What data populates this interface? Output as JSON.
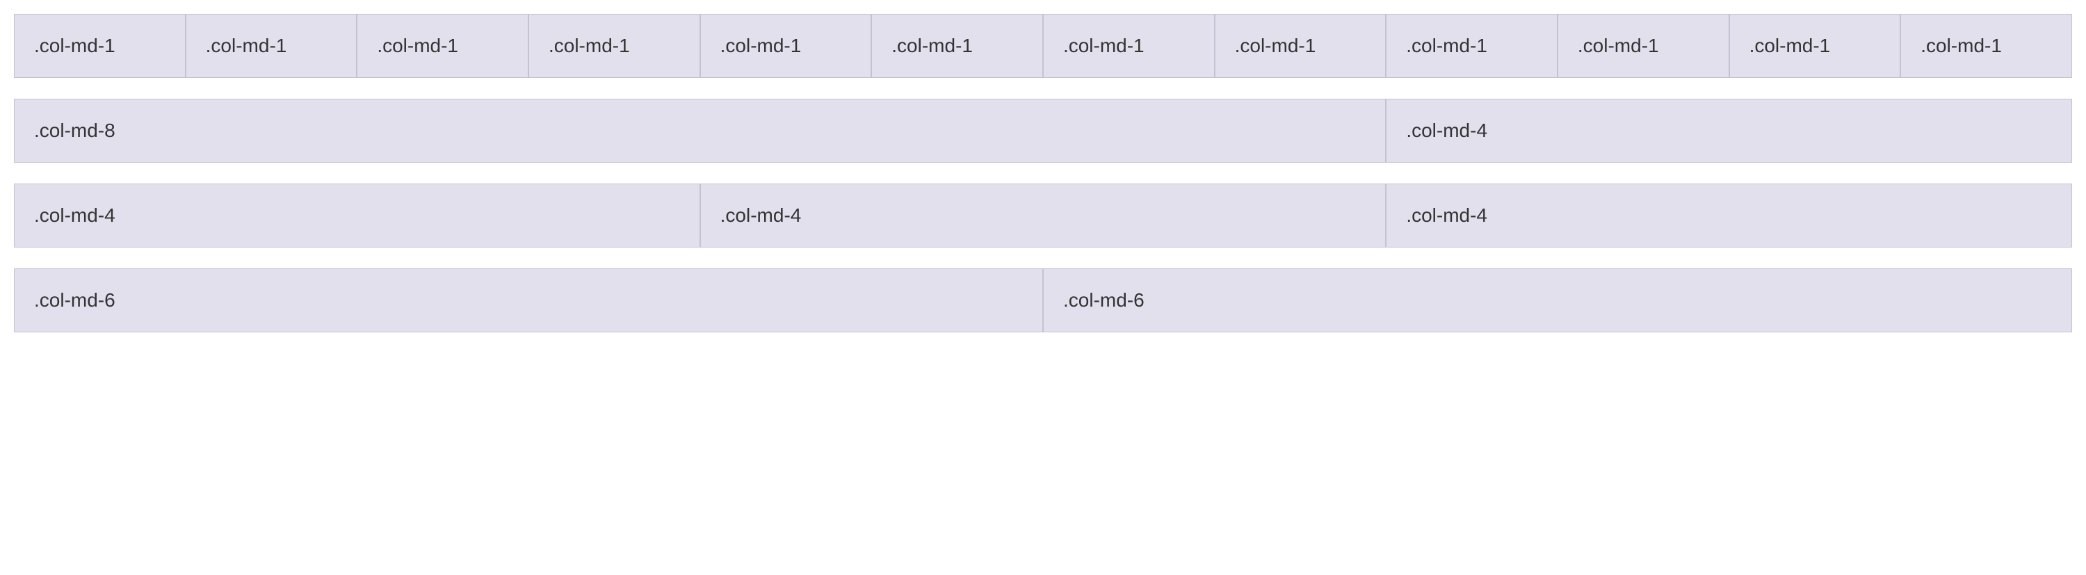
{
  "rows": [
    {
      "cols": [
        {
          "span": 1,
          "label": ".col-md-1"
        },
        {
          "span": 1,
          "label": ".col-md-1"
        },
        {
          "span": 1,
          "label": ".col-md-1"
        },
        {
          "span": 1,
          "label": ".col-md-1"
        },
        {
          "span": 1,
          "label": ".col-md-1"
        },
        {
          "span": 1,
          "label": ".col-md-1"
        },
        {
          "span": 1,
          "label": ".col-md-1"
        },
        {
          "span": 1,
          "label": ".col-md-1"
        },
        {
          "span": 1,
          "label": ".col-md-1"
        },
        {
          "span": 1,
          "label": ".col-md-1"
        },
        {
          "span": 1,
          "label": ".col-md-1"
        },
        {
          "span": 1,
          "label": ".col-md-1"
        }
      ]
    },
    {
      "cols": [
        {
          "span": 8,
          "label": ".col-md-8"
        },
        {
          "span": 4,
          "label": ".col-md-4"
        }
      ]
    },
    {
      "cols": [
        {
          "span": 4,
          "label": ".col-md-4"
        },
        {
          "span": 4,
          "label": ".col-md-4"
        },
        {
          "span": 4,
          "label": ".col-md-4"
        }
      ]
    },
    {
      "cols": [
        {
          "span": 6,
          "label": ".col-md-6"
        },
        {
          "span": 6,
          "label": ".col-md-6"
        }
      ]
    }
  ]
}
